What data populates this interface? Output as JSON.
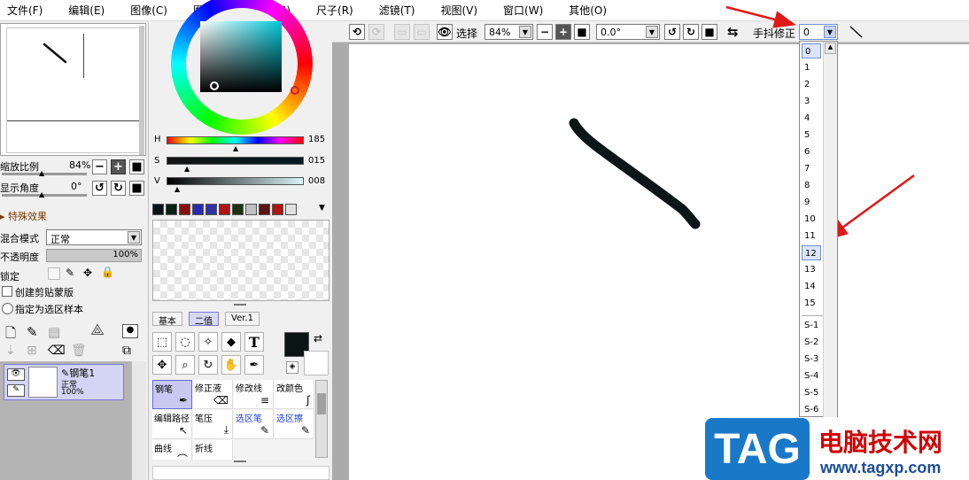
{
  "menubar": {
    "items": [
      "文件(F)",
      "编辑(E)",
      "图像(C)",
      "图层(L)",
      "选择(S)",
      "尺子(R)",
      "滤镜(T)",
      "视图(V)",
      "窗口(W)",
      "其他(O)"
    ]
  },
  "navigator": {
    "zoom_label": "缩放比例",
    "zoom_value": "84%",
    "angle_label": "显示角度",
    "angle_value": "0°"
  },
  "layer_props": {
    "effects_label": "特殊效果",
    "blend_label": "混合模式",
    "blend_value": "正常",
    "opacity_label": "不透明度",
    "opacity_value": "100%",
    "lock_label": "锁定",
    "clip_label": "创建剪贴蒙版",
    "sample_label": "指定为选区样本"
  },
  "layer": {
    "name": "钢笔1",
    "mode": "正常",
    "opacity": "100%"
  },
  "color": {
    "h_label": "H",
    "h_value": "185",
    "s_label": "S",
    "s_value": "015",
    "v_label": "V",
    "v_value": "008",
    "swatches": [
      "#0a1414",
      "#0a1e14",
      "#8a1010",
      "#2a2ab0",
      "#3232a8",
      "#b01414",
      "#1e3214",
      "#c0c0c0",
      "#5a1414",
      "#b01414",
      "#e0e0e0"
    ],
    "primary": "#0b1414",
    "secondary": "#ffffff"
  },
  "tool_tabs": [
    "基本",
    "二值",
    "Ver.1"
  ],
  "tools": {
    "text_tool": "T"
  },
  "brushes": [
    {
      "label": "钢笔",
      "active": true
    },
    {
      "label": "修正液",
      "active": false
    },
    {
      "label": "修改线",
      "active": false
    },
    {
      "label": "改颜色",
      "active": false
    },
    {
      "label": "编辑路径",
      "active": false
    },
    {
      "label": "笔压",
      "active": false
    },
    {
      "label": "选区笔",
      "active": false,
      "blue": true
    },
    {
      "label": "选区擦",
      "active": false,
      "blue": true
    },
    {
      "label": "曲线",
      "active": false
    },
    {
      "label": "折线",
      "active": false
    }
  ],
  "toolbar": {
    "select_label": "选择",
    "zoom_value": "84%",
    "angle_value": "0.0°",
    "stabilizer_label": "手抖修正",
    "stabilizer_value": "0"
  },
  "stabilizer_options": [
    "0",
    "1",
    "2",
    "3",
    "4",
    "5",
    "6",
    "7",
    "8",
    "9",
    "10",
    "11",
    "12",
    "13",
    "14",
    "15",
    "S-1",
    "S-2",
    "S-3",
    "S-4",
    "S-5",
    "S-6"
  ],
  "stabilizer_selected": "12",
  "watermark": {
    "logo": "TAG",
    "title": "电脑技术网",
    "url": "www.tagxp.com"
  }
}
